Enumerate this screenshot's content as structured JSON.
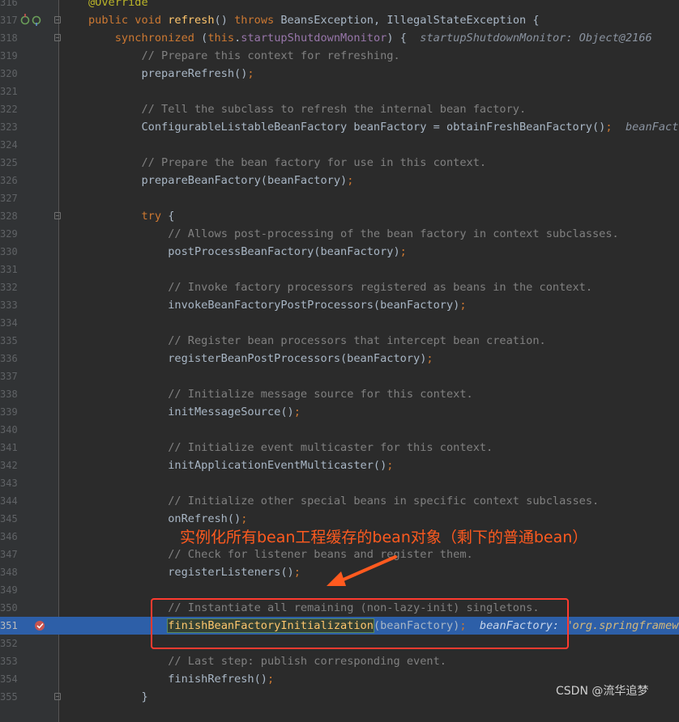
{
  "editor": {
    "lines": [
      {
        "num": "316",
        "segments": [
          {
            "t": "@Override",
            "c": "ann"
          }
        ]
      },
      {
        "num": "317",
        "icons": true,
        "fold": true,
        "segments": [
          {
            "t": "public ",
            "c": "kw"
          },
          {
            "t": "void ",
            "c": "kw"
          },
          {
            "t": "refresh",
            "c": "fn"
          },
          {
            "t": "() "
          },
          {
            "t": "throws ",
            "c": "kw"
          },
          {
            "t": "BeansException, IllegalStateException {"
          }
        ]
      },
      {
        "num": "318",
        "fold": true,
        "segments": [
          {
            "t": "    "
          },
          {
            "t": "synchronized ",
            "c": "kw"
          },
          {
            "t": "("
          },
          {
            "t": "this",
            "c": "kw"
          },
          {
            "t": "."
          },
          {
            "t": "startupShutdownMonitor",
            "c": "fld"
          },
          {
            "t": ") {  "
          },
          {
            "t": "startupShutdownMonitor: Object@2166",
            "c": "hint"
          }
        ]
      },
      {
        "num": "319",
        "segments": [
          {
            "t": "        "
          },
          {
            "t": "// Prepare this context for refreshing.",
            "c": "cmt"
          }
        ]
      },
      {
        "num": "320",
        "segments": [
          {
            "t": "        prepareRefresh()"
          },
          {
            "t": ";",
            "c": "kw"
          }
        ]
      },
      {
        "num": "321",
        "segments": []
      },
      {
        "num": "322",
        "segments": [
          {
            "t": "        "
          },
          {
            "t": "// Tell the subclass to refresh the internal bean factory.",
            "c": "cmt"
          }
        ]
      },
      {
        "num": "323",
        "segments": [
          {
            "t": "        ConfigurableListableBeanFactory beanFactory = obtainFreshBeanFactory()"
          },
          {
            "t": ";",
            "c": "kw"
          },
          {
            "t": "  "
          },
          {
            "t": "beanFactory",
            "c": "hint"
          }
        ]
      },
      {
        "num": "324",
        "segments": []
      },
      {
        "num": "325",
        "segments": [
          {
            "t": "        "
          },
          {
            "t": "// Prepare the bean factory for use in this context.",
            "c": "cmt"
          }
        ]
      },
      {
        "num": "326",
        "segments": [
          {
            "t": "        prepareBeanFactory(beanFactory)"
          },
          {
            "t": ";",
            "c": "kw"
          }
        ]
      },
      {
        "num": "327",
        "segments": []
      },
      {
        "num": "328",
        "fold": true,
        "segments": [
          {
            "t": "        "
          },
          {
            "t": "try ",
            "c": "kw"
          },
          {
            "t": "{"
          }
        ]
      },
      {
        "num": "329",
        "segments": [
          {
            "t": "            "
          },
          {
            "t": "// Allows post-processing of the bean factory in context subclasses.",
            "c": "cmt"
          }
        ]
      },
      {
        "num": "330",
        "segments": [
          {
            "t": "            postProcessBeanFactory(beanFactory)"
          },
          {
            "t": ";",
            "c": "kw"
          }
        ]
      },
      {
        "num": "331",
        "segments": []
      },
      {
        "num": "332",
        "segments": [
          {
            "t": "            "
          },
          {
            "t": "// Invoke factory processors registered as beans in the context.",
            "c": "cmt"
          }
        ]
      },
      {
        "num": "333",
        "segments": [
          {
            "t": "            invokeBeanFactoryPostProcessors(beanFactory)"
          },
          {
            "t": ";",
            "c": "kw"
          }
        ]
      },
      {
        "num": "334",
        "segments": []
      },
      {
        "num": "335",
        "segments": [
          {
            "t": "            "
          },
          {
            "t": "// Register bean processors that intercept bean creation.",
            "c": "cmt"
          }
        ]
      },
      {
        "num": "336",
        "segments": [
          {
            "t": "            registerBeanPostProcessors(beanFactory)"
          },
          {
            "t": ";",
            "c": "kw"
          }
        ]
      },
      {
        "num": "337",
        "segments": []
      },
      {
        "num": "338",
        "segments": [
          {
            "t": "            "
          },
          {
            "t": "// Initialize message source for this context.",
            "c": "cmt"
          }
        ]
      },
      {
        "num": "339",
        "segments": [
          {
            "t": "            initMessageSource()"
          },
          {
            "t": ";",
            "c": "kw"
          }
        ]
      },
      {
        "num": "340",
        "segments": []
      },
      {
        "num": "341",
        "segments": [
          {
            "t": "            "
          },
          {
            "t": "// Initialize event multicaster for this context.",
            "c": "cmt"
          }
        ]
      },
      {
        "num": "342",
        "segments": [
          {
            "t": "            initApplicationEventMulticaster()"
          },
          {
            "t": ";",
            "c": "kw"
          }
        ]
      },
      {
        "num": "343",
        "segments": []
      },
      {
        "num": "344",
        "segments": [
          {
            "t": "            "
          },
          {
            "t": "// Initialize other special beans in specific context subclasses.",
            "c": "cmt"
          }
        ]
      },
      {
        "num": "345",
        "segments": [
          {
            "t": "            onRefresh()"
          },
          {
            "t": ";",
            "c": "kw"
          }
        ]
      },
      {
        "num": "346",
        "segments": []
      },
      {
        "num": "347",
        "segments": [
          {
            "t": "            "
          },
          {
            "t": "// Check for listener beans and register them.",
            "c": "cmt"
          }
        ]
      },
      {
        "num": "348",
        "segments": [
          {
            "t": "            registerListeners()"
          },
          {
            "t": ";",
            "c": "kw"
          }
        ]
      },
      {
        "num": "349",
        "segments": []
      },
      {
        "num": "350",
        "segments": [
          {
            "t": "            "
          },
          {
            "t": "// Instantiate all remaining (non-lazy-init) singletons.",
            "c": "cmt"
          }
        ]
      },
      {
        "num": "351",
        "exec": true,
        "breakpoint": true,
        "segments": [
          {
            "t": "            "
          },
          {
            "t": "finishBeanFactoryInitialization",
            "c": "sel-word"
          },
          {
            "t": "(beanFactory)"
          },
          {
            "t": ";",
            "c": "kw"
          },
          {
            "t": "  "
          },
          {
            "t": "beanFactory: ",
            "c": "hint-exec"
          },
          {
            "t": "\"org.springframework",
            "c": "str"
          }
        ]
      },
      {
        "num": "352",
        "segments": []
      },
      {
        "num": "353",
        "segments": [
          {
            "t": "            "
          },
          {
            "t": "// Last step: publish corresponding event.",
            "c": "cmt"
          }
        ]
      },
      {
        "num": "354",
        "segments": [
          {
            "t": "            finishRefresh()"
          },
          {
            "t": ";",
            "c": "kw"
          }
        ]
      },
      {
        "num": "355",
        "fold": true,
        "segments": [
          {
            "t": "        }"
          }
        ]
      }
    ]
  },
  "annotation": {
    "label": "实例化所有bean工程缓存的bean对象（剩下的普通bean）",
    "color": "#ff5a1f"
  },
  "watermark": {
    "text": "CSDN @流华追梦"
  },
  "colors": {
    "background": "#2b2b2b",
    "keyword": "#cc7832",
    "method": "#ffc66d",
    "comment": "#808080",
    "execution_line": "#2d5fa8",
    "highlight_box": "#ff3b2f"
  }
}
